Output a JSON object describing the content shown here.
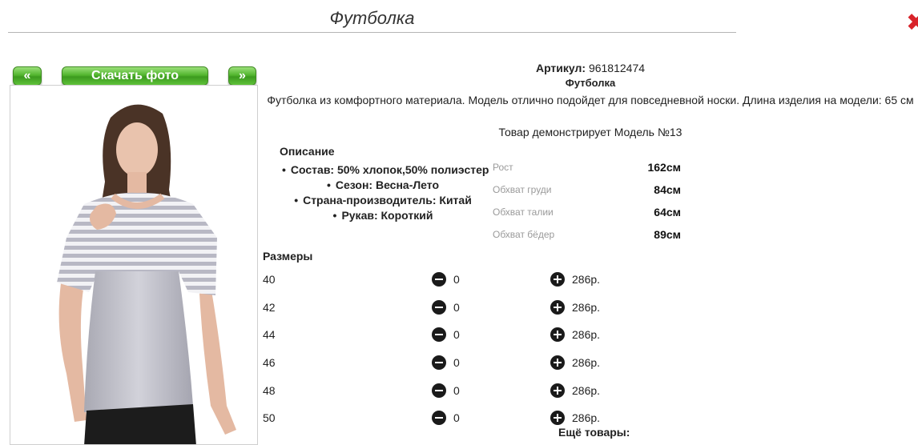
{
  "header": {
    "title": "Футболка"
  },
  "gallery": {
    "prev_label": "«",
    "download_label": "Скачать фото",
    "next_label": "»"
  },
  "product": {
    "article_label": "Артикул:",
    "article_value": "961812474",
    "name": "Футболка",
    "description": "Футболка из комфортного материала. Модель отлично подойдет для повседневной носки. Длина изделия на модели: 65 см",
    "model_note": "Товар демонстрирует Модель №13",
    "description_heading": "Описание",
    "attributes": [
      "Состав: 50% хлопок,50% полиэстер",
      "Сезон: Весна-Лето",
      "Страна-производитель: Китай",
      "Рукав: Короткий"
    ]
  },
  "model_measurements": [
    {
      "label": "Рост",
      "value": "162см"
    },
    {
      "label": "Обхват груди",
      "value": "84см"
    },
    {
      "label": "Обхват талии",
      "value": "64см"
    },
    {
      "label": "Обхват бёдер",
      "value": "89см"
    }
  ],
  "sizes": {
    "heading": "Размеры",
    "rows": [
      {
        "size": "40",
        "qty": "0",
        "price": "286р."
      },
      {
        "size": "42",
        "qty": "0",
        "price": "286р."
      },
      {
        "size": "44",
        "qty": "0",
        "price": "286р."
      },
      {
        "size": "46",
        "qty": "0",
        "price": "286р."
      },
      {
        "size": "48",
        "qty": "0",
        "price": "286р."
      },
      {
        "size": "50",
        "qty": "0",
        "price": "286р."
      }
    ]
  },
  "footer": {
    "more_products": "Ещё товары:"
  },
  "colors": {
    "accent_green": "#52b52e",
    "close_red": "#d8232a"
  }
}
